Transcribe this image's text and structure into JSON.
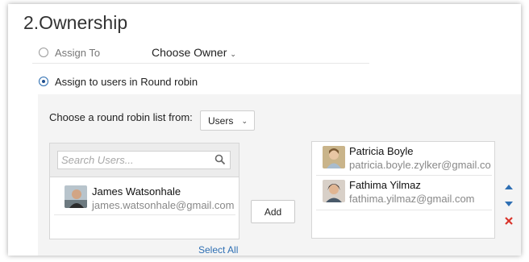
{
  "section": {
    "title": "2.Ownership"
  },
  "assign_to": {
    "label": "Assign To",
    "owner_select": "Choose Owner",
    "selected": false
  },
  "round_robin": {
    "label": "Assign to users in Round robin",
    "selected": true
  },
  "list_choice": {
    "label": "Choose a round robin list from:",
    "selected_option": "Users"
  },
  "available": {
    "search_placeholder": "Search Users...",
    "users": [
      {
        "name": "James Watsonhale",
        "email": "james.watsonhale@gmail.com"
      }
    ],
    "select_all": "Select All"
  },
  "add_button": "Add",
  "selected_users": [
    {
      "name": "Patricia Boyle",
      "email": "patricia.boyle.zylker@gmail.co"
    },
    {
      "name": "Fathima Yilmaz",
      "email": "fathima.yilmaz@gmail.com"
    }
  ],
  "colors": {
    "accent": "#2e6fb3",
    "remove": "#d9342b"
  },
  "icons": [
    "search-icon",
    "move-up-icon",
    "move-down-icon",
    "remove-icon"
  ]
}
